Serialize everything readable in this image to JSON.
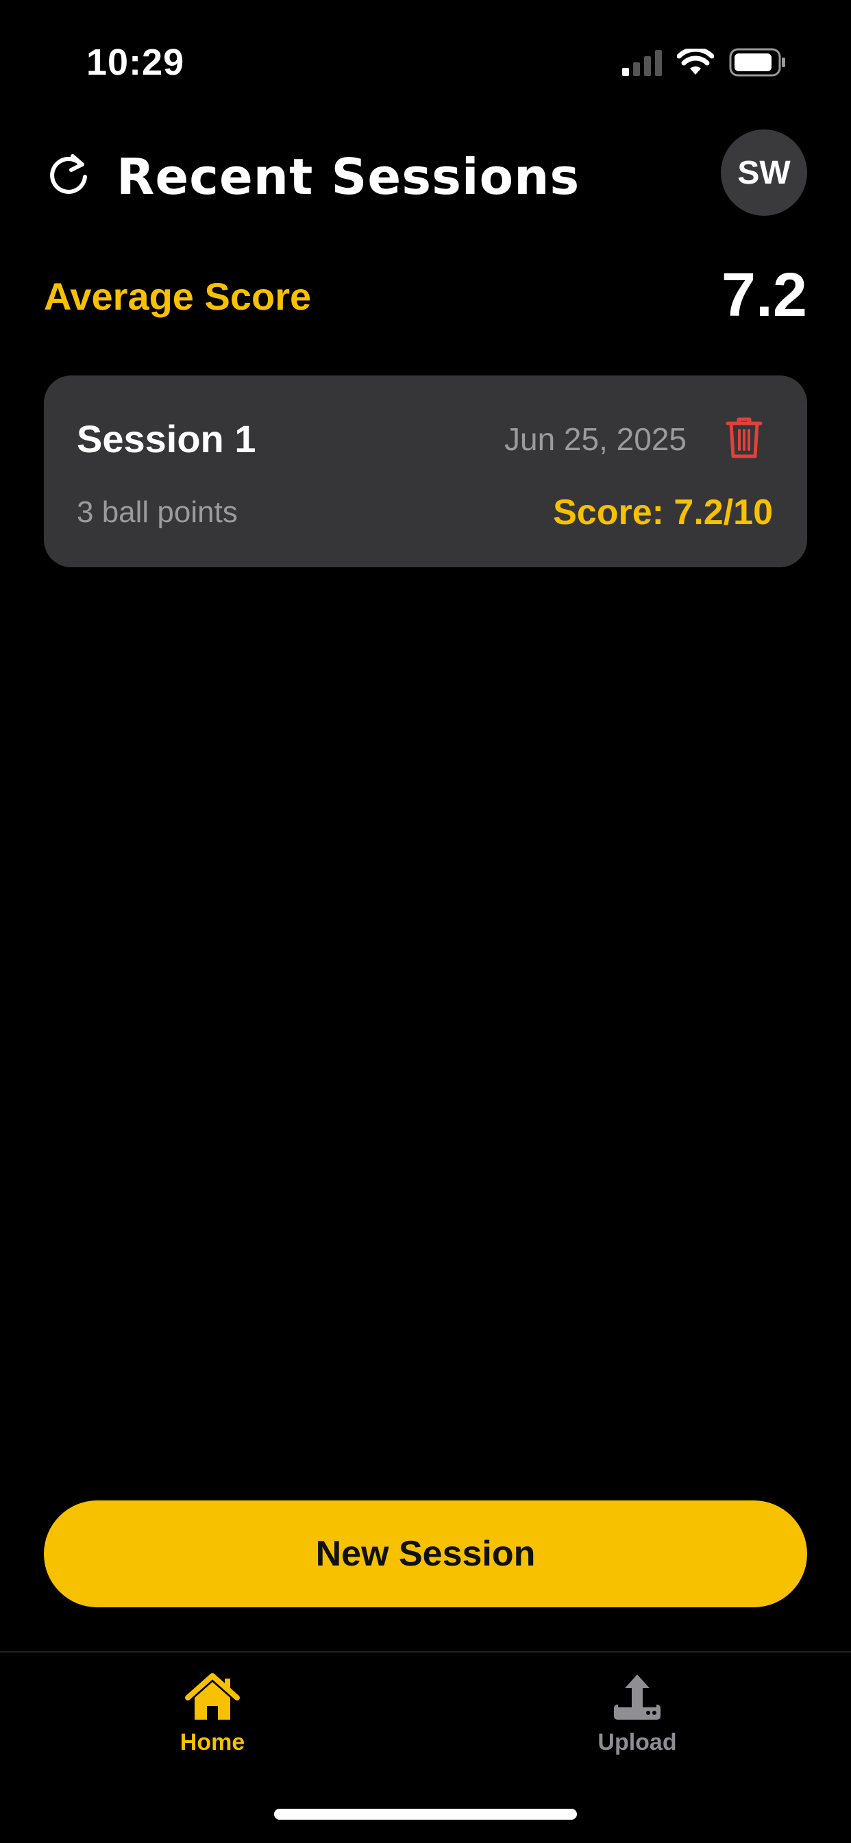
{
  "status_bar": {
    "time": "10:29",
    "icons": [
      "cellular-signal-icon",
      "wifi-icon",
      "battery-icon"
    ]
  },
  "header": {
    "title": "Recent Sessions",
    "refresh_icon": "refresh-icon",
    "avatar_initials": "SW"
  },
  "summary": {
    "average_label": "Average Score",
    "average_value": "7.2"
  },
  "sessions": [
    {
      "title": "Session 1",
      "date": "Jun 25, 2025",
      "points": "3 ball points",
      "score": "Score: 7.2/10",
      "delete_icon": "trash-icon"
    }
  ],
  "actions": {
    "new_session_label": "New Session"
  },
  "tab_bar": {
    "tabs": [
      {
        "label": "Home",
        "icon": "home-icon",
        "active": true
      },
      {
        "label": "Upload",
        "icon": "upload-icon",
        "active": false
      }
    ]
  },
  "colors": {
    "background": "#000000",
    "accent": "#f7c100",
    "card": "#363638",
    "muted_text": "#9b9b9f",
    "delete": "#e0423b",
    "inactive_tab": "#8e8e93"
  }
}
